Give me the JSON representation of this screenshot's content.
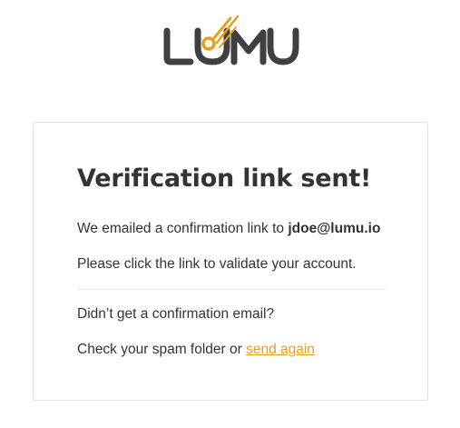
{
  "brand": {
    "logo_text": "LUMU",
    "accent_color": "#e8a01c",
    "text_color": "#404040"
  },
  "card": {
    "title": "Verification link sent!",
    "emailed_prefix": "We emailed a confirmation link to ",
    "email": "jdoe@lumu.io",
    "validate_text": "Please click the link to validate your account.",
    "didnt_get_text": "Didn’t get a confirmation email?",
    "spam_prefix": "Check your spam folder or ",
    "send_again_label": "send again"
  }
}
